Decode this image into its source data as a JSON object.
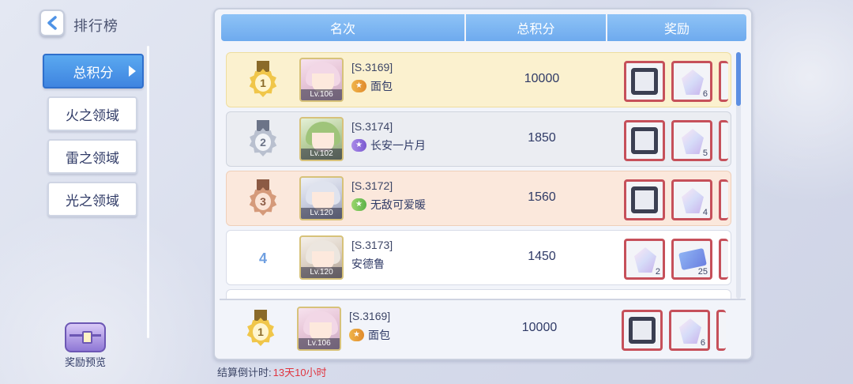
{
  "header_bar": {
    "title": "排行榜"
  },
  "side_nav": {
    "items": [
      {
        "label": "总积分",
        "active": true
      },
      {
        "label": "火之领域",
        "active": false
      },
      {
        "label": "雷之领域",
        "active": false
      },
      {
        "label": "光之领域",
        "active": false
      }
    ],
    "reward_preview_label": "奖励预览"
  },
  "table": {
    "columns": [
      "名次",
      "总积分",
      "奖励"
    ],
    "rows": [
      {
        "rank": "1",
        "server_id": "[S.3169]",
        "level": "Lv.106",
        "name": "面包",
        "score": "10000",
        "rewards": [
          {
            "icon": "frame-icon",
            "count": ""
          },
          {
            "icon": "crystal-icon",
            "count": "6"
          }
        ]
      },
      {
        "rank": "2",
        "server_id": "[S.3174]",
        "level": "Lv.102",
        "name": "长安一片月",
        "score": "1850",
        "rewards": [
          {
            "icon": "frame-icon",
            "count": ""
          },
          {
            "icon": "crystal-icon",
            "count": "5"
          }
        ]
      },
      {
        "rank": "3",
        "server_id": "[S.3172]",
        "level": "Lv.120",
        "name": "无敌可爱暖",
        "score": "1560",
        "rewards": [
          {
            "icon": "frame-icon",
            "count": ""
          },
          {
            "icon": "crystal-icon",
            "count": "4"
          }
        ]
      },
      {
        "rank": "4",
        "server_id": "[S.3173]",
        "level": "Lv.120",
        "name": "安德鲁",
        "score": "1450",
        "rewards": [
          {
            "icon": "crystal-icon",
            "count": "2"
          },
          {
            "icon": "ticket-icon",
            "count": "25"
          }
        ]
      }
    ]
  },
  "my_rank": {
    "rank": "1",
    "server_id": "[S.3169]",
    "level": "Lv.106",
    "name": "面包",
    "score": "10000",
    "rewards": [
      {
        "icon": "frame-icon",
        "count": ""
      },
      {
        "icon": "crystal-icon",
        "count": "6"
      }
    ]
  },
  "countdown": {
    "label": "结算倒计时:",
    "value": "13天10小时"
  },
  "colors": {
    "accent_blue": "#4f93e6",
    "gold_row": "#fbf1cf",
    "silver_row": "#ebedf2",
    "bronze_row": "#fbe8dc",
    "countdown_red": "#e0353f"
  }
}
